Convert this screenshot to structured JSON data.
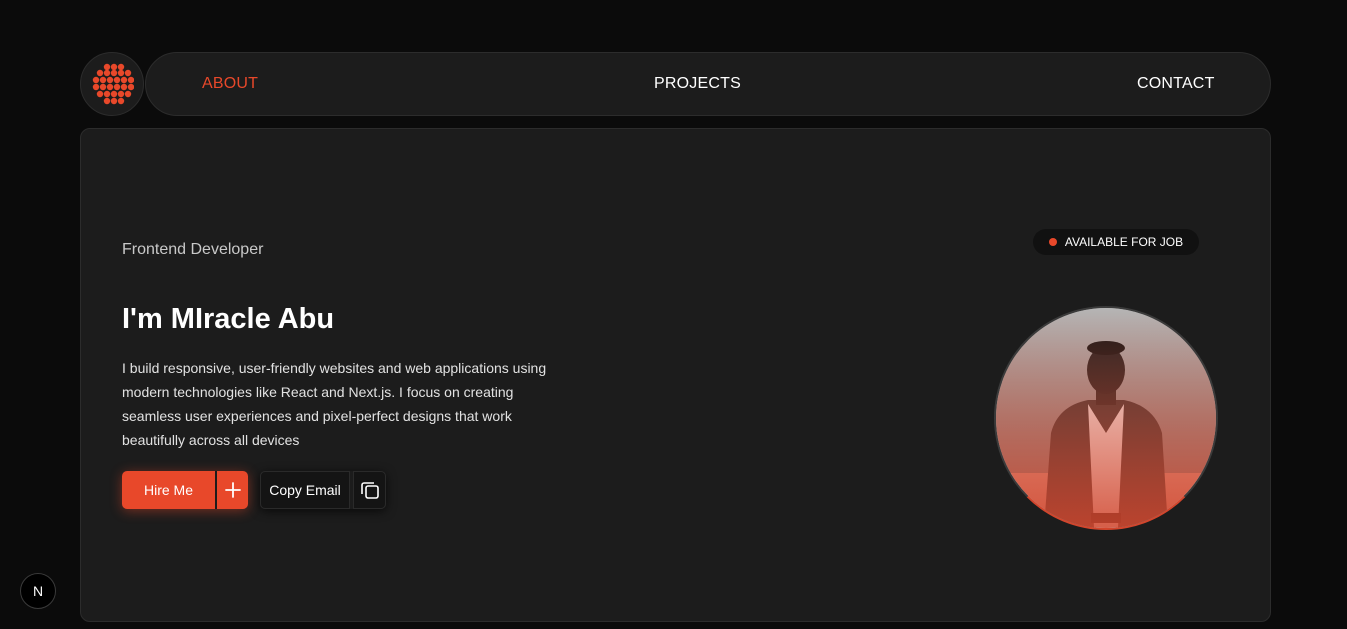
{
  "brand": {
    "logo_icon": "dot-grid-logo-icon",
    "accent": "#e8482a"
  },
  "nav": {
    "items": [
      {
        "label": "ABOUT",
        "active": true
      },
      {
        "label": "PROJECTS",
        "active": false
      },
      {
        "label": "CONTACT",
        "active": false
      }
    ]
  },
  "hero": {
    "role": "Frontend Developer",
    "headline": "I'm MIracle Abu",
    "bio": "I build responsive, user-friendly websites and web applications using modern technologies like React and Next.js. I focus on creating seamless user experiences and pixel-perfect designs that work beautifully across all devices",
    "status": "AVAILABLE FOR JOB",
    "buttons": {
      "hire": "Hire Me",
      "hire_icon": "plus-icon",
      "copy": "Copy Email",
      "copy_icon": "copy-icon"
    },
    "avatar_icon": "profile-photo"
  },
  "devtools": {
    "label": "N"
  }
}
